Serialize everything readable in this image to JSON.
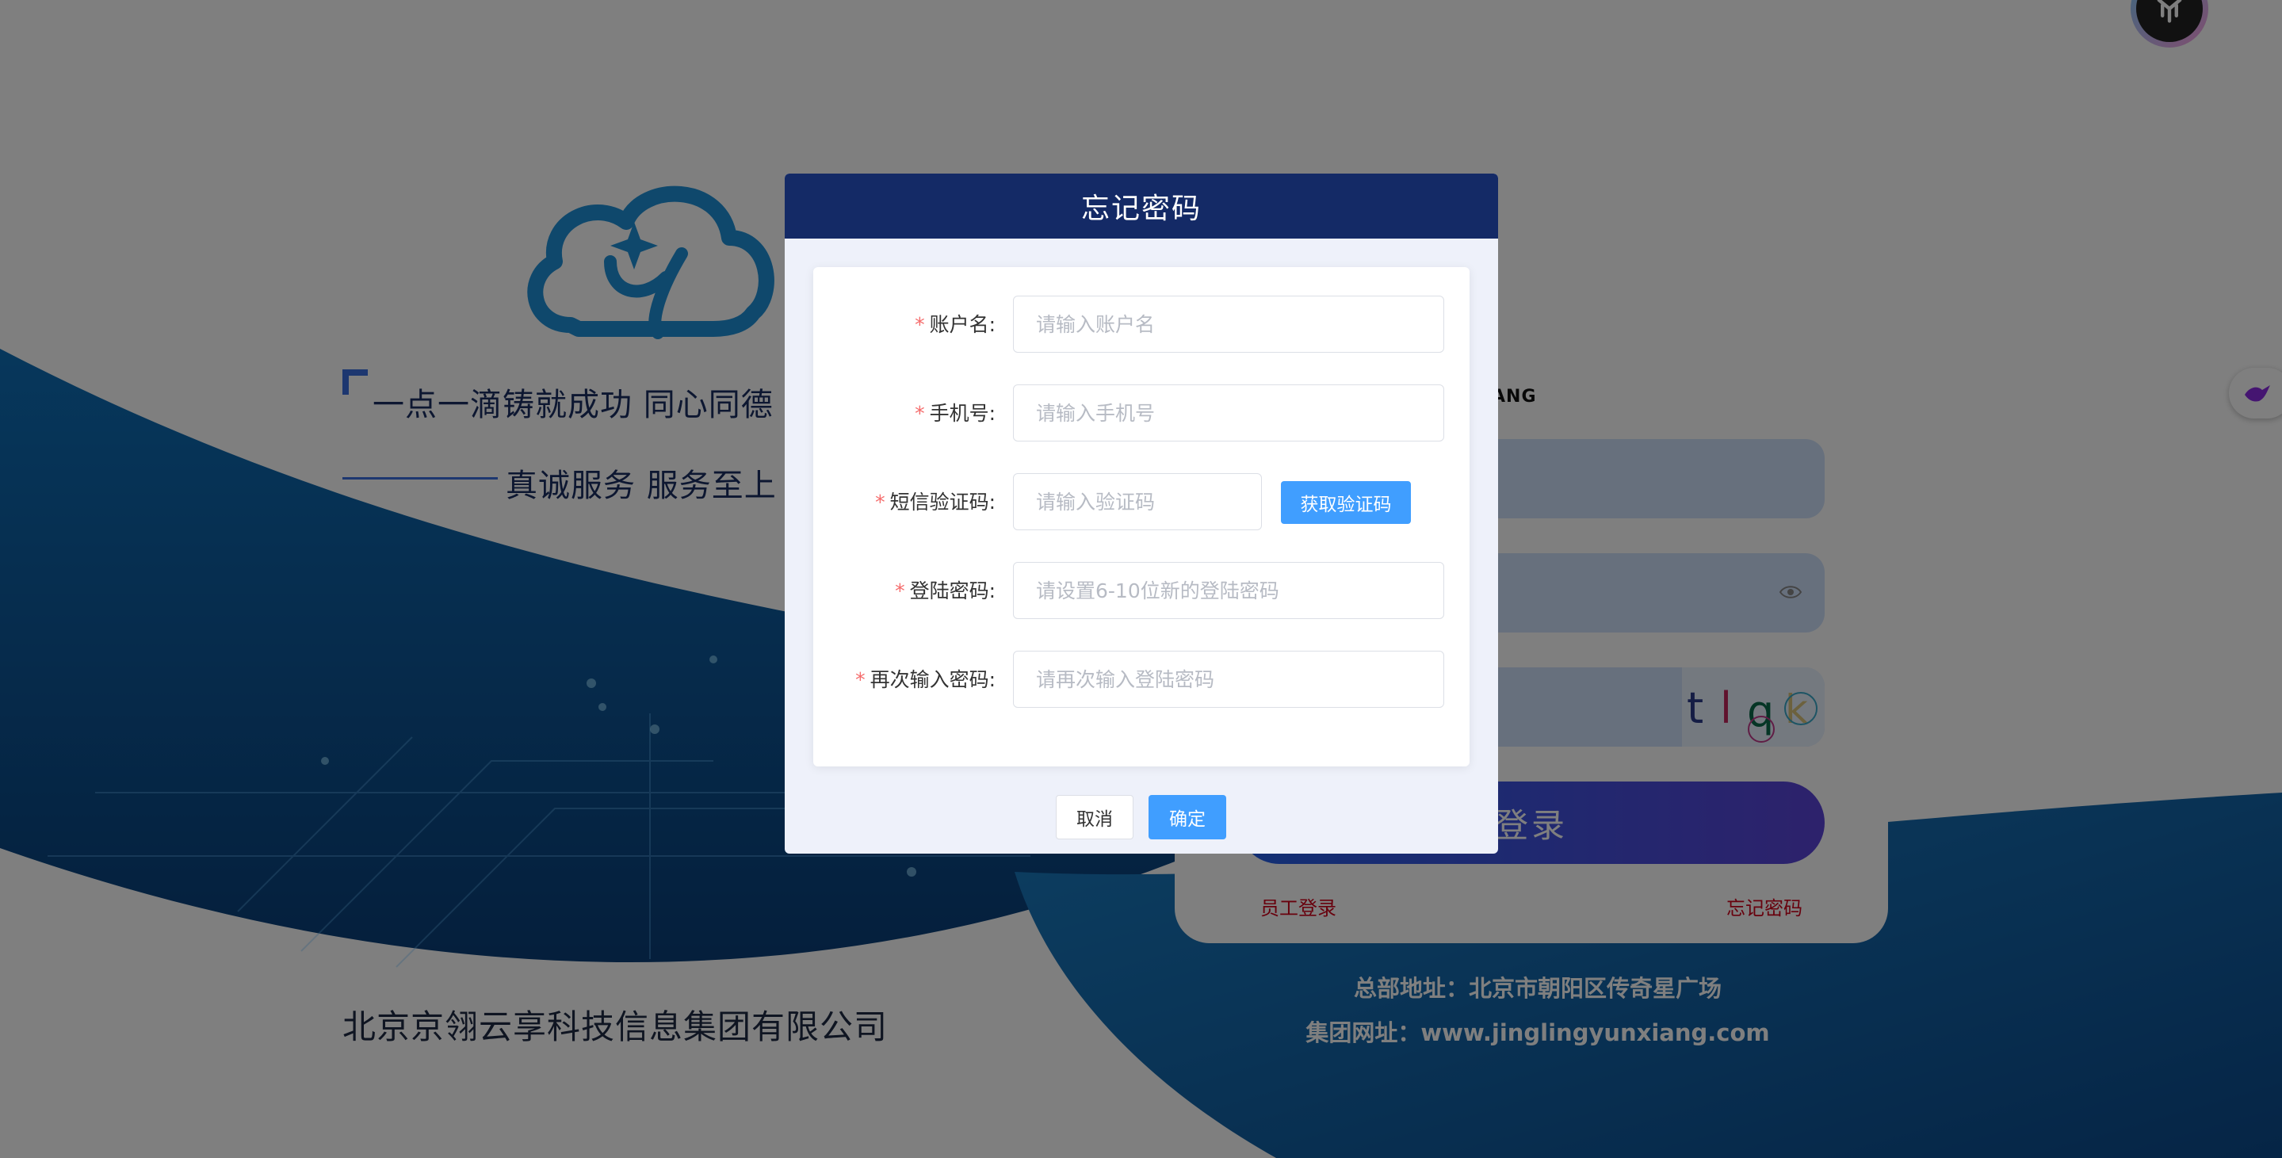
{
  "background": {
    "slogan_line1": "一点一滴铸就成功 同心同德",
    "slogan_line2": "真诚服务 服务至上",
    "company_name": "北京京翎云享科技信息集团有限公司"
  },
  "login_card": {
    "subtitle_fragment": "ANG",
    "captcha_chars": [
      "t",
      "l",
      "q",
      "k"
    ],
    "login_button": "登录",
    "staff_login_link": "员工登录",
    "forgot_password_link": "忘记密码"
  },
  "footer": {
    "address": "总部地址：北京市朝阳区传奇星广场",
    "website": "集团网址：www.jinglingyunxiang.com"
  },
  "dialog": {
    "title": "忘记密码",
    "fields": [
      {
        "label": "账户名:",
        "placeholder": "请输入账户名"
      },
      {
        "label": "手机号:",
        "placeholder": "请输入手机号"
      },
      {
        "label": "短信验证码:",
        "placeholder": "请输入验证码"
      },
      {
        "label": "登陆密码:",
        "placeholder": "请设置6-10位新的登陆密码"
      },
      {
        "label": "再次输入密码:",
        "placeholder": "请再次输入登陆密码"
      }
    ],
    "required_mark": "*",
    "get_code_button": "获取验证码",
    "cancel_button": "取消",
    "confirm_button": "确定"
  },
  "colors": {
    "dialog_header": "#142A66",
    "primary_button": "#409EFF",
    "required": "#f56c6c",
    "link_red": "#d0021b",
    "wave_blue": "#0A5FA8"
  },
  "icons": [
    "cloud-logo-icon",
    "eye-icon",
    "bird-icon",
    "avatar-icon"
  ]
}
